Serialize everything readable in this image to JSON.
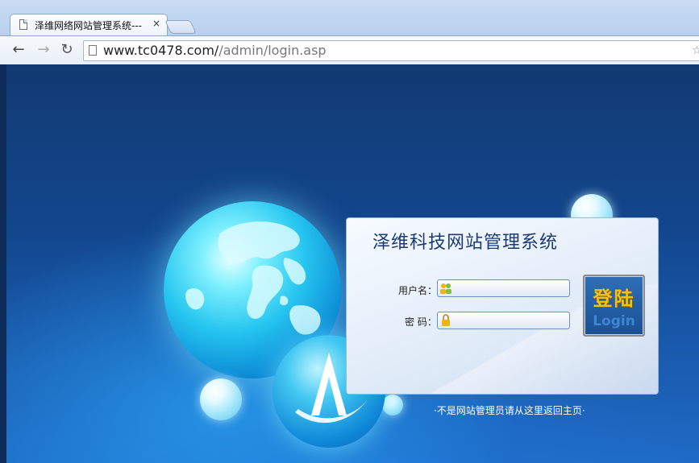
{
  "browser": {
    "tab_title": "泽维网络网站管理系统---",
    "tab_close": "×",
    "url_host": "www.tc0478.com/",
    "url_path": "/admin/login.asp"
  },
  "login": {
    "title": "泽维科技网站管理系统",
    "username_label": "用户名：",
    "password_label": "密 码：",
    "button_cn": "登陆",
    "button_en": "Login"
  },
  "footer": {
    "return_text": "·不是网站管理员请从这里返回主页·"
  },
  "colors": {
    "page_bg": "#1a5cb0",
    "title_color": "#1b3a73",
    "button_gold": "#f3c21a"
  }
}
